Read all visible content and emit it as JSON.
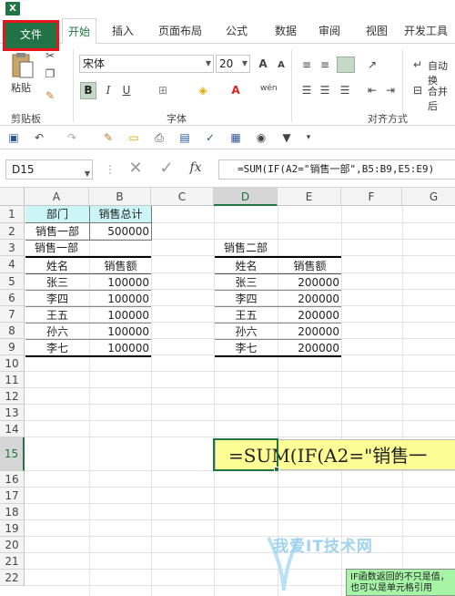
{
  "app": {
    "logo": "X"
  },
  "ribbon": {
    "tabs": [
      "文件",
      "开始",
      "插入",
      "页面布局",
      "公式",
      "数据",
      "审阅",
      "视图",
      "开发工具"
    ],
    "clipboard": {
      "paste_label": "粘贴",
      "group_label": "剪贴板"
    },
    "font": {
      "name": "宋体",
      "size": "20",
      "group_label": "字体",
      "bold": "B",
      "italic": "I",
      "underline": "U",
      "pinyin": "wén",
      "grow": "A",
      "shrink": "A"
    },
    "alignment": {
      "wrap_label": "自动换",
      "merge_label": "合并后",
      "group_label": "对齐方式"
    }
  },
  "formula_bar": {
    "name_box": "D15",
    "fx": "fx",
    "formula": "=SUM(IF(A2=\"销售一部\",B5:B9,E5:E9)"
  },
  "columns": [
    "A",
    "B",
    "C",
    "D",
    "E",
    "F",
    "G"
  ],
  "selected_column": "D",
  "rows": [
    "1",
    "2",
    "3",
    "4",
    "5",
    "6",
    "7",
    "8",
    "9",
    "10",
    "11",
    "12",
    "13",
    "14",
    "15",
    "16",
    "17",
    "18",
    "19",
    "20",
    "21",
    "22"
  ],
  "selected_row": "15",
  "summary": {
    "dept_header": "部门",
    "total_header": "销售总计",
    "dept_value": "销售一部",
    "total_value": "500000"
  },
  "table1": {
    "title": "销售一部",
    "headers": [
      "姓名",
      "销售额"
    ],
    "rows": [
      [
        "张三",
        "100000"
      ],
      [
        "李四",
        "100000"
      ],
      [
        "王五",
        "100000"
      ],
      [
        "孙六",
        "100000"
      ],
      [
        "李七",
        "100000"
      ]
    ]
  },
  "table2": {
    "title": "销售二部",
    "headers": [
      "姓名",
      "销售额"
    ],
    "rows": [
      [
        "张三",
        "200000"
      ],
      [
        "李四",
        "200000"
      ],
      [
        "王五",
        "200000"
      ],
      [
        "孙六",
        "200000"
      ],
      [
        "李七",
        "200000"
      ]
    ]
  },
  "formula_popup": "=SUM(IF(A2=\"销售一",
  "tooltip": "IF函数返回的不只是值，也可以是单元格引用",
  "watermark": "我爱IT技术网",
  "colors": {
    "accent": "#217346",
    "header_fill": "#ccf5f7",
    "popup_fill": "#fdfd96",
    "file_border": "#e8141a"
  }
}
